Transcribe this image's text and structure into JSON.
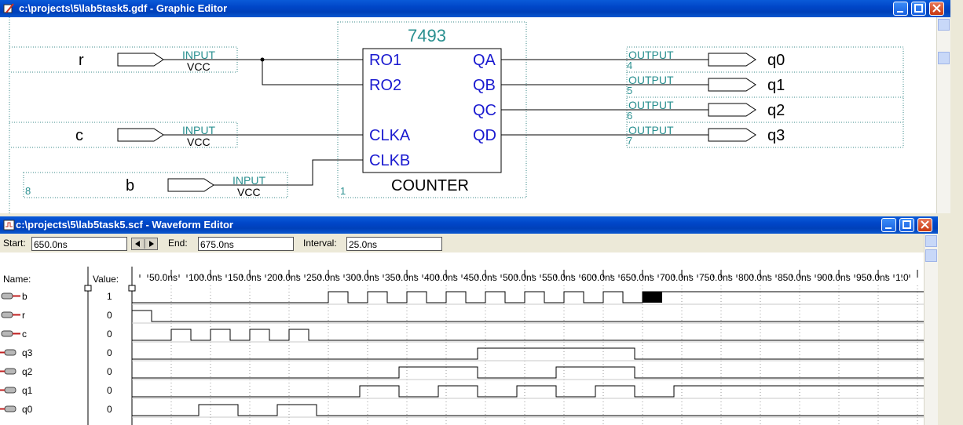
{
  "graphic_editor": {
    "title": "c:\\projects\\5\\lab5task5.gdf - Graphic Editor",
    "inputs": [
      {
        "name": "r",
        "type": "INPUT",
        "vcc": "VCC"
      },
      {
        "name": "c",
        "type": "INPUT",
        "vcc": "VCC"
      },
      {
        "name": "b",
        "type": "INPUT",
        "vcc": "VCC",
        "number": "8"
      }
    ],
    "counter": {
      "part": "7493",
      "left_pins": [
        "RO1",
        "RO2",
        "CLKA",
        "CLKB"
      ],
      "right_pins": [
        "QA",
        "QB",
        "QC",
        "QD"
      ],
      "label": "COUNTER",
      "number": "1"
    },
    "outputs": [
      {
        "name": "q0",
        "type": "OUTPUT",
        "number": "4"
      },
      {
        "name": "q1",
        "type": "OUTPUT",
        "number": "5"
      },
      {
        "name": "q2",
        "type": "OUTPUT",
        "number": "6"
      },
      {
        "name": "q3",
        "type": "OUTPUT",
        "number": "7"
      }
    ]
  },
  "waveform_editor": {
    "title": "c:\\projects\\5\\lab5task5.scf - Waveform Editor",
    "toolbar": {
      "start_label": "Start:",
      "start_value": "650.0ns",
      "end_label": "End:",
      "end_value": "675.0ns",
      "interval_label": "Interval:",
      "interval_value": "25.0ns"
    },
    "name_header": "Name:",
    "value_header": "Value:",
    "time_ticks": [
      "50.0ns",
      "100.0ns",
      "150.0ns",
      "200.0ns",
      "250.0ns",
      "300.0ns",
      "350.0ns",
      "400.0ns",
      "450.0ns",
      "500.0ns",
      "550.0ns",
      "600.0ns",
      "650.0ns",
      "700.0ns",
      "750.0ns",
      "800.0ns",
      "850.0ns",
      "900.0ns",
      "950.0ns",
      "1.0"
    ],
    "signals": [
      {
        "name": "b",
        "kind": "input",
        "value": "1",
        "transitions_ns": [
          250,
          275,
          300,
          325,
          350,
          375,
          400,
          425,
          450,
          475,
          500,
          525,
          550,
          575,
          600,
          625,
          650
        ],
        "initial": 0,
        "cursor_high": [
          650,
          675
        ]
      },
      {
        "name": "r",
        "kind": "input",
        "value": "0",
        "transitions_ns": [
          25
        ],
        "initial": 1
      },
      {
        "name": "c",
        "kind": "input",
        "value": "0",
        "transitions_ns": [
          50,
          75,
          100,
          125,
          150,
          175,
          200,
          225
        ],
        "initial": 0
      },
      {
        "name": "q3",
        "kind": "output",
        "value": "0",
        "transitions_ns": [
          440,
          640
        ],
        "initial": 0
      },
      {
        "name": "q2",
        "kind": "output",
        "value": "0",
        "transitions_ns": [
          340,
          440,
          540,
          640
        ],
        "initial": 0
      },
      {
        "name": "q1",
        "kind": "output",
        "value": "0",
        "transitions_ns": [
          290,
          340,
          390,
          440,
          490,
          540,
          590,
          640,
          690
        ],
        "initial": 0
      },
      {
        "name": "q0",
        "kind": "output",
        "value": "0",
        "transitions_ns": [
          85,
          135,
          185,
          235
        ],
        "initial": 0
      }
    ]
  }
}
